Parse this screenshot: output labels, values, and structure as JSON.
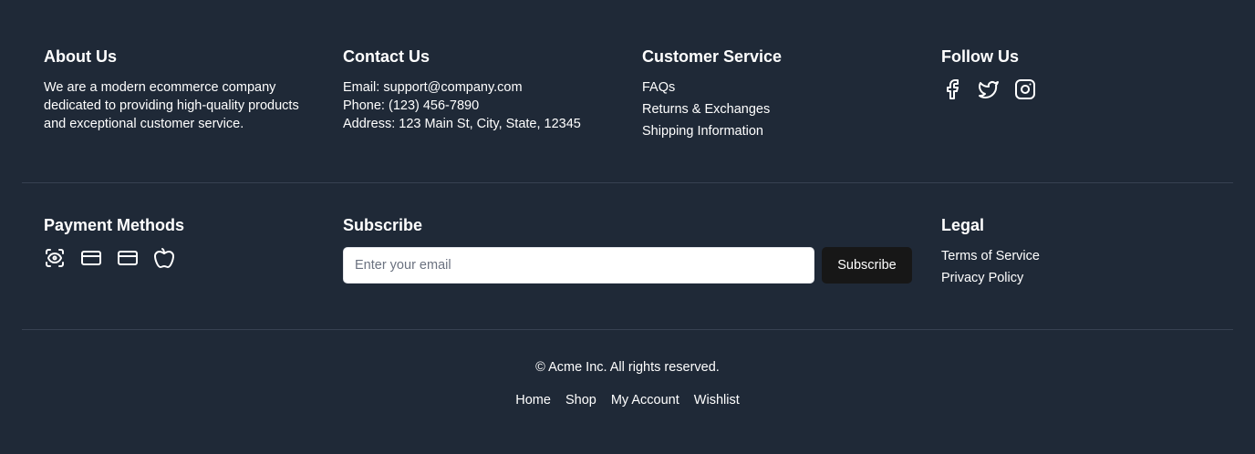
{
  "about": {
    "title": "About Us",
    "text": "We are a modern ecommerce company dedicated to providing high-quality products and exceptional customer service."
  },
  "contact": {
    "title": "Contact Us",
    "email": "Email: support@company.com",
    "phone": "Phone: (123) 456-7890",
    "address": "Address: 123 Main St, City, State, 12345"
  },
  "customer_service": {
    "title": "Customer Service",
    "links": [
      "FAQs",
      "Returns & Exchanges",
      "Shipping Information"
    ]
  },
  "follow": {
    "title": "Follow Us",
    "icons": [
      "facebook-icon",
      "twitter-icon",
      "instagram-icon"
    ]
  },
  "payment": {
    "title": "Payment Methods",
    "icons": [
      "paypal-icon",
      "credit-card-icon",
      "credit-card-icon",
      "apple-pay-icon"
    ]
  },
  "subscribe": {
    "title": "Subscribe",
    "placeholder": "Enter your email",
    "button_label": "Subscribe"
  },
  "legal": {
    "title": "Legal",
    "links": [
      "Terms of Service",
      "Privacy Policy"
    ]
  },
  "bottom": {
    "copyright": "© Acme Inc. All rights reserved.",
    "nav": [
      "Home",
      "Shop",
      "My Account",
      "Wishlist"
    ]
  },
  "colors": {
    "background": "#1f2937",
    "divider": "#374151",
    "button": "#171717",
    "text": "#ffffff"
  }
}
